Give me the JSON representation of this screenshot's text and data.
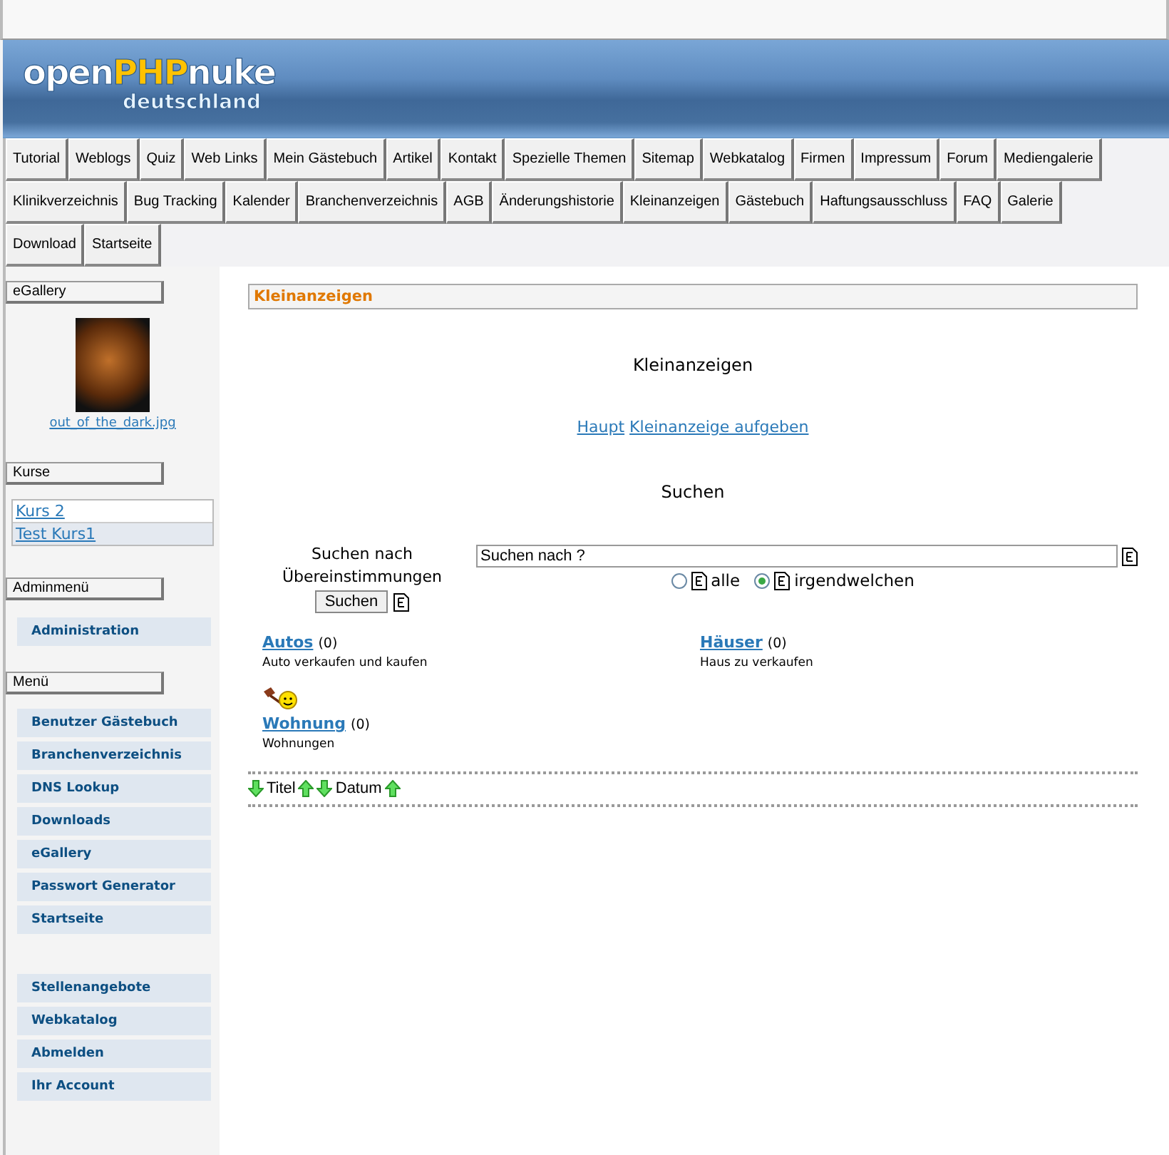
{
  "banner": {
    "logo_open": "open",
    "logo_php": "PHP",
    "logo_nuke": "nuke",
    "logo_sub": "deutschland"
  },
  "nav_rows": [
    [
      "Tutorial",
      "Weblogs",
      "Quiz",
      "Web Links",
      "Mein Gästebuch",
      "Artikel",
      "Kontakt",
      "Spezielle Themen",
      "Sitemap",
      "Webkatalog",
      "Firmen",
      "Impressum",
      "Forum",
      "Mediengalerie"
    ],
    [
      "Klinikverzeichnis",
      "Bug Tracking",
      "Kalender",
      "Branchenverzeichnis",
      "AGB",
      "Änderungshistorie",
      "Kleinanzeigen",
      "Gästebuch",
      "Haftungsausschluss",
      "FAQ",
      "Galerie"
    ],
    [
      "Download",
      "Startseite"
    ]
  ],
  "sidebar": {
    "gallery": {
      "title": "eGallery",
      "image_caption": "out_of_the_dark.jpg"
    },
    "courses": {
      "title": "Kurse",
      "items": [
        "Kurs 2",
        "Test Kurs1"
      ]
    },
    "admin": {
      "title": "Adminmenü",
      "items": [
        "Administration"
      ]
    },
    "menu": {
      "title": "Menü",
      "groups": [
        [
          "Benutzer Gästebuch",
          "Branchenverzeichnis",
          "DNS Lookup",
          "Downloads",
          "eGallery",
          "Passwort Generator",
          "Startseite"
        ],
        [
          "Stellenangebote",
          "Webkatalog",
          "Abmelden",
          "Ihr Account"
        ]
      ]
    }
  },
  "main": {
    "box_title": "Kleinanzeigen",
    "heading": "Kleinanzeigen",
    "links": [
      "Haupt",
      "Kleinanzeige aufgeben"
    ],
    "search_heading": "Suchen",
    "search": {
      "label_1": "Suchen nach",
      "label_2": "Übereinstimmungen",
      "button": "Suchen",
      "value": "Suchen nach ?",
      "options": [
        {
          "label": "alle",
          "selected": false
        },
        {
          "label": "irgendwelchen",
          "selected": true
        }
      ]
    },
    "categories": [
      {
        "name": "Autos",
        "count": "(0)",
        "description": "Auto verkaufen und kaufen",
        "has_icons": false
      },
      {
        "name": "Häuser",
        "count": "(0)",
        "description": "Haus zu verkaufen",
        "has_icons": false
      },
      {
        "name": "Wohnung",
        "count": "(0)",
        "description": "Wohnungen",
        "has_icons": true
      }
    ],
    "sort": {
      "first": "Titel",
      "second": "Datum"
    }
  }
}
